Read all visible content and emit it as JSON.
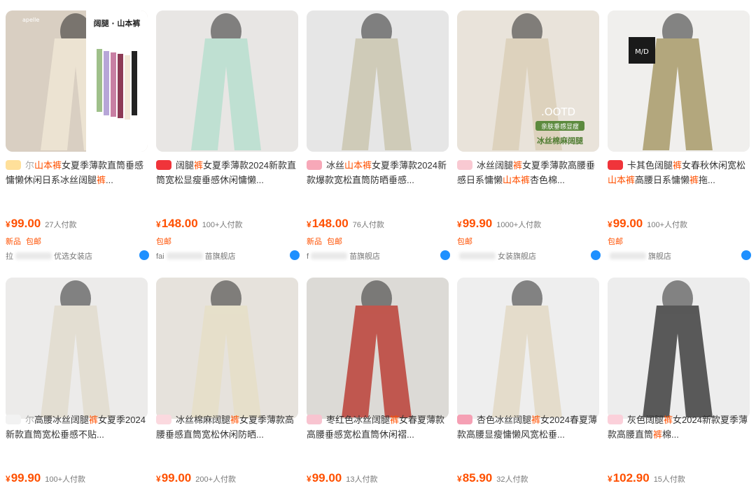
{
  "products": [
    {
      "title_pre": "",
      "title_blur": "尔",
      "title_parts": [
        [
          "山本裤",
          true
        ],
        [
          "女夏季薄款直筒垂感慵懒休闲日系冰丝阔腿",
          false
        ],
        [
          "裤",
          true
        ],
        [
          "...",
          false
        ]
      ],
      "price": "99.00",
      "sales": "27人付款",
      "tags": [
        "新品",
        "包邮"
      ],
      "shop_pre": "拉",
      "shop_post": "优选女装店",
      "badge_color": "#ffe09a",
      "image_text_1": "阔腿 · 山本裤",
      "image_text_2": "apelle",
      "img_bg": "#d9cfc2",
      "pants_color": "#ece3d2"
    },
    {
      "title_blur": "",
      "title_parts": [
        [
          "阔腿",
          false
        ],
        [
          "裤",
          true
        ],
        [
          "女夏季薄款2024新款直筒宽松显瘦垂感休闲慵懒...",
          false
        ]
      ],
      "price": "148.00",
      "sales": "100+人付款",
      "tags": [
        "包邮"
      ],
      "shop_pre": "fai",
      "shop_post": "苗旗舰店",
      "badge_color": "#f0343a",
      "img_bg": "#e8e6e4",
      "pants_color": "#bfe0d2"
    },
    {
      "title_blur": "",
      "title_parts": [
        [
          "冰丝",
          false
        ],
        [
          "山本裤",
          true
        ],
        [
          "女夏季薄款2024新款爆款宽松直筒防晒垂感...",
          false
        ]
      ],
      "price": "148.00",
      "sales": "76人付款",
      "tags": [
        "新品",
        "包邮"
      ],
      "shop_pre": "f",
      "shop_post": "苗旗舰店",
      "badge_color": "#f7a8b8",
      "img_bg": "#e6e6e6",
      "pants_color": "#cfcbb8"
    },
    {
      "title_blur": "",
      "title_parts": [
        [
          "冰丝阔腿",
          false
        ],
        [
          "裤",
          true
        ],
        [
          "女夏季薄款高腰垂感日系慵懒",
          false
        ],
        [
          "山本裤",
          true
        ],
        [
          "杏色棉...",
          false
        ]
      ],
      "price": "99.90",
      "sales": "1000+人付款",
      "tags": [
        "包邮"
      ],
      "shop_pre": "",
      "shop_post": "女装旗舰店",
      "badge_color": "#f9c9d2",
      "image_text_1": ".OOTD",
      "image_text_2": "亲肤垂感显瘦",
      "image_text_3": "冰丝棉麻阔腿",
      "img_bg": "#e9e3da",
      "pants_color": "#ddd2bd"
    },
    {
      "title_blur": "",
      "title_parts": [
        [
          "卡其色阔腿",
          false
        ],
        [
          "裤",
          true
        ],
        [
          "女春秋休闲宽松",
          false
        ],
        [
          "山本裤",
          true
        ],
        [
          "高腰日系慵懒",
          false
        ],
        [
          "裤",
          true
        ],
        [
          "拖...",
          false
        ]
      ],
      "price": "99.00",
      "sales": "100+人付款",
      "tags": [
        "包邮"
      ],
      "shop_pre": "",
      "shop_post": "旗舰店",
      "badge_color": "#f0343a",
      "image_text_1": "M/D",
      "img_bg": "#f0efed",
      "pants_color": "#b3a77d"
    },
    {
      "title_blur": "尔",
      "title_parts": [
        [
          "高腰冰丝阔腿",
          false
        ],
        [
          "裤",
          true
        ],
        [
          "女夏季2024新款直筒宽松垂感不贴...",
          false
        ]
      ],
      "price": "99.90",
      "sales": "100+人付款",
      "tags": [],
      "badge_color": "#f2f2f2",
      "img_bg": "#ecebea",
      "pants_color": "#e3ded2"
    },
    {
      "title_blur": "",
      "title_parts": [
        [
          "冰丝棉麻阔腿",
          false
        ],
        [
          "裤",
          true
        ],
        [
          "女夏季薄款高腰垂感直筒宽松休闲防晒...",
          false
        ]
      ],
      "price": "99.00",
      "sales": "200+人付款",
      "tags": [],
      "badge_color": "#fbd9df",
      "img_bg": "#e6e2dc",
      "pants_color": "#e6dfca"
    },
    {
      "title_blur": "",
      "title_parts": [
        [
          "枣红色冰丝阔腿",
          false
        ],
        [
          "裤",
          true
        ],
        [
          "女春夏薄款高腰垂感宽松直筒休闲褶...",
          false
        ]
      ],
      "price": "99.00",
      "sales": "13人付款",
      "tags": [],
      "badge_color": "#f8c4d0",
      "img_bg": "#dcdad6",
      "pants_color": "#c0574f"
    },
    {
      "title_blur": "",
      "title_parts": [
        [
          "杏色冰丝阔腿",
          false
        ],
        [
          "裤",
          true
        ],
        [
          "女2024春夏薄款高腰显瘦慵懒风宽松垂...",
          false
        ]
      ],
      "price": "85.90",
      "sales": "32人付款",
      "tags": [],
      "badge_color": "#f5a0b4",
      "img_bg": "#eeeeee",
      "pants_color": "#e4dccb"
    },
    {
      "title_blur": "",
      "title_parts": [
        [
          "灰色阔腿",
          false
        ],
        [
          "裤",
          true
        ],
        [
          "女2024新款夏季薄款高腰直筒",
          false
        ],
        [
          "裤",
          true
        ],
        [
          "棉...",
          false
        ]
      ],
      "price": "102.90",
      "sales": "15人付款",
      "tags": [],
      "badge_color": "#fbd0da",
      "img_bg": "#ededed",
      "pants_color": "#595959"
    }
  ],
  "currency": "¥"
}
